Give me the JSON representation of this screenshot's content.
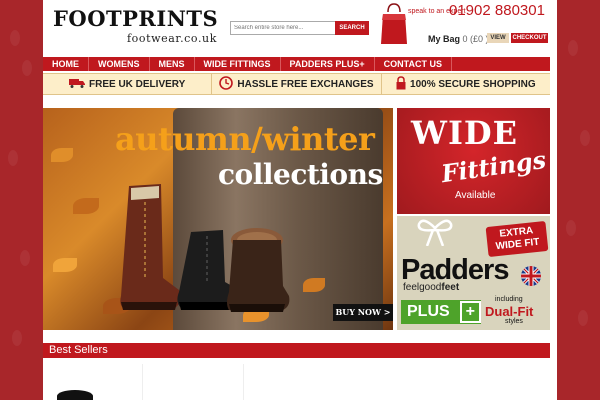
{
  "header": {
    "logo_main": "FOOTPRINTS",
    "logo_sub": "footwear.co.uk",
    "search_placeholder": "Search entire store here...",
    "search_button": "SEARCH",
    "expert_text": "speak to an expert",
    "phone": "01902 880301",
    "bag_label": "My Bag",
    "bag_count": "0 (£0 )",
    "view_label": "VIEW",
    "checkout_label": "CHECKOUT"
  },
  "nav": {
    "items": [
      "HOME",
      "WOMENS",
      "MENS",
      "WIDE FITTINGS",
      "PADDERS PLUS+",
      "CONTACT US"
    ]
  },
  "usp": {
    "items": [
      {
        "label": "FREE UK DELIVERY",
        "icon": "truck-icon"
      },
      {
        "label": "HASSLE FREE EXCHANGES",
        "icon": "clock-icon"
      },
      {
        "label": "100% SECURE SHOPPING",
        "icon": "lock-icon"
      }
    ]
  },
  "hero": {
    "title_line1": "autumn/winter",
    "title_line2": "collections",
    "buy_now": "BUY NOW >"
  },
  "wide_panel": {
    "title": "WIDE",
    "subtitle": "Fittings",
    "available": "Available"
  },
  "padders_panel": {
    "badge_line1": "EXTRA",
    "badge_line2": "WIDE FIT",
    "brand": "Padders",
    "tagline_prefix": "feelgood",
    "tagline_suffix": "feet",
    "plus_label": "PLUS",
    "plus_sign": "+",
    "including": "including",
    "dualfit": "Dual-Fit",
    "styles": "styles"
  },
  "best_sellers": {
    "title": "Best Sellers"
  },
  "colors": {
    "brand_red": "#c0181e",
    "background_red": "#a8262a",
    "usp_bg": "#fdeec9",
    "green": "#4ea32a"
  }
}
